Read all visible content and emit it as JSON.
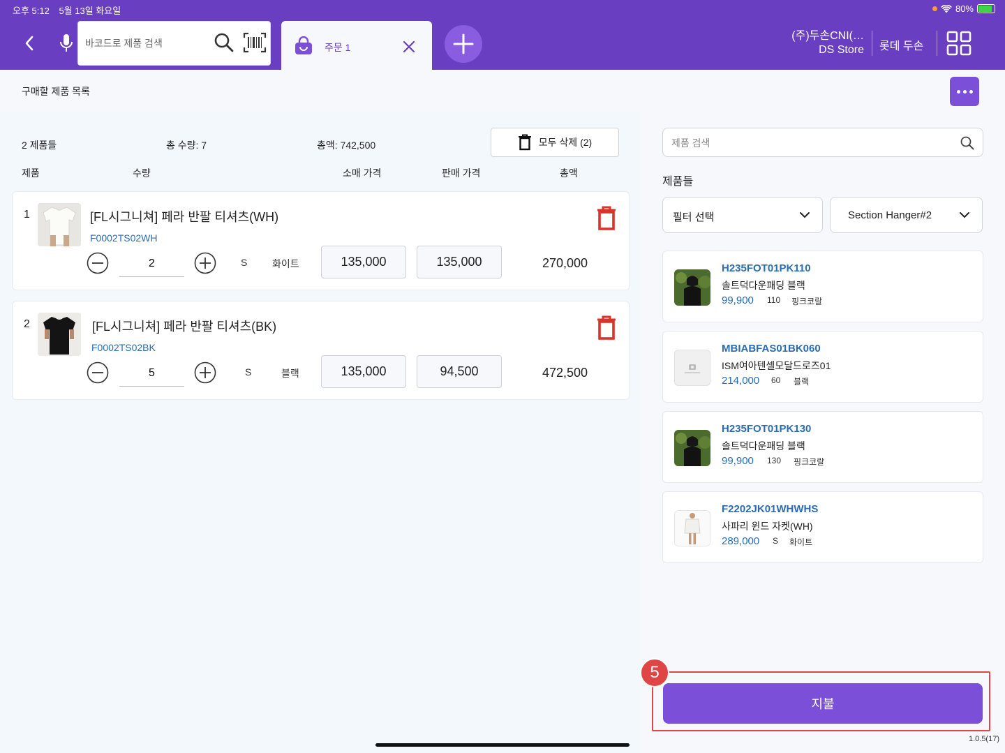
{
  "status": {
    "time": "오후 5:12",
    "date": "5월 13일 화요일",
    "battery": "80%"
  },
  "header": {
    "search_placeholder": "바코드로 제품 검색",
    "order_tab_label": "주문 1",
    "company_line1": "(주)두손CNI(…",
    "company_line2": "DS Store",
    "store": "롯데 두손"
  },
  "page_title": "구매할 제품 목록",
  "summary": {
    "count": "2 제품들",
    "total_qty": "총 수량: 7",
    "total_amount": "총액: 742,500",
    "clear_all": "모두 삭제 (2)"
  },
  "columns": {
    "product": "제품",
    "qty": "수량",
    "retail": "소매 가격",
    "sale": "판매 가격",
    "total": "총액"
  },
  "cart": [
    {
      "idx": "1",
      "name": "[FL시그니쳐] 페라 반팔 티셔츠(WH)",
      "code": "F0002TS02WH",
      "qty": "2",
      "size": "S",
      "color": "화이트",
      "retail": "135,000",
      "sale": "135,000",
      "total": "270,000"
    },
    {
      "idx": "2",
      "name": "[FL시그니쳐] 페라 반팔 티셔츠(BK)",
      "code": "F0002TS02BK",
      "qty": "5",
      "size": "S",
      "color": "블랙",
      "retail": "135,000",
      "sale": "94,500",
      "total": "472,500"
    }
  ],
  "right": {
    "search_placeholder": "제품 검색",
    "title": "제품들",
    "filter": "필터 선택",
    "section": "Section Hanger#2",
    "products": [
      {
        "code": "H235FOT01PK110",
        "name": "솔트덕다운패딩 블랙",
        "price": "99,900",
        "size": "110",
        "color": "핑크코랄"
      },
      {
        "code": "MBIABFAS01BK060",
        "name": "ISM여아텐셀모달드로즈01",
        "price": "214,000",
        "size": "60",
        "color": "블랙"
      },
      {
        "code": "H235FOT01PK130",
        "name": "솔트덕다운패딩 블랙",
        "price": "99,900",
        "size": "130",
        "color": "핑크코랄"
      },
      {
        "code": "F2202JK01WHWHS",
        "name": "사파리 윈드 자켓(WH)",
        "price": "289,000",
        "size": "S",
        "color": "화이트"
      }
    ]
  },
  "pay_label": "지불",
  "step_badge": "5",
  "version": "1.0.5(17)",
  "colors": {
    "brand": "#6a3ec0",
    "button": "#7b4fd8",
    "link": "#2b6cb0",
    "danger": "#d9342b",
    "highlight": "#e04545"
  }
}
